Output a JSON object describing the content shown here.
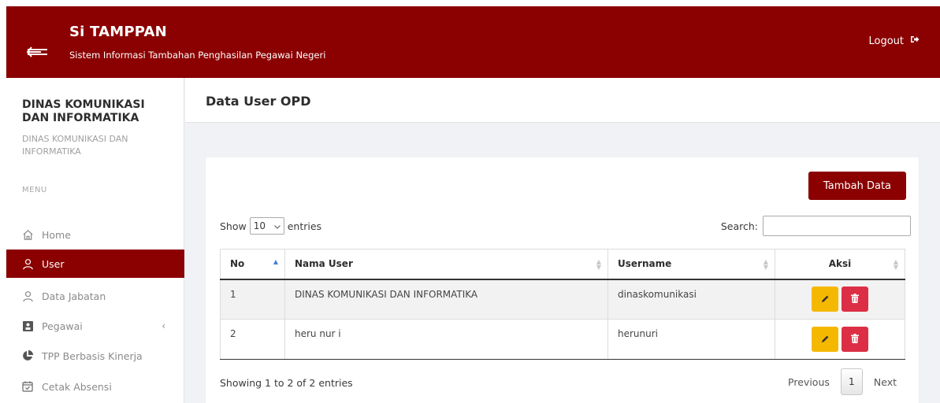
{
  "header": {
    "title": "Si TAMPPAN",
    "subtitle": "Sistem Informasi Tambahan Penghasilan Pegawai Negeri",
    "logout_label": "Logout"
  },
  "sidebar": {
    "org_name": "DINAS KOMUNIKASI DAN INFORMATIKA",
    "org_sub": "DINAS KOMUNIKASI DAN INFORMATIKA",
    "menu_label": "MENU",
    "items": [
      {
        "label": "Home",
        "icon": "home-icon"
      },
      {
        "label": "User",
        "icon": "user-icon",
        "active": true
      },
      {
        "label": "Data Jabatan",
        "icon": "user-icon"
      },
      {
        "label": "Pegawai",
        "icon": "id-card-icon",
        "has_children": true
      },
      {
        "label": "TPP Berbasis Kinerja",
        "icon": "pie-chart-icon"
      },
      {
        "label": "Cetak Absensi",
        "icon": "calendar-check-icon"
      }
    ]
  },
  "page": {
    "title": "Data User OPD",
    "add_button": "Tambah Data",
    "show_label": "Show",
    "entries_label": "entries",
    "length_value": "10",
    "search_label": "Search:",
    "search_value": ""
  },
  "table": {
    "columns": [
      "No",
      "Nama User",
      "Username",
      "Aksi"
    ],
    "rows": [
      {
        "no": "1",
        "nama": "DINAS KOMUNIKASI DAN INFORMATIKA",
        "username": "dinaskomunikasi"
      },
      {
        "no": "2",
        "nama": "heru nur i",
        "username": "herunuri"
      }
    ]
  },
  "footer": {
    "info": "Showing 1 to 2 of 2 entries",
    "previous": "Previous",
    "current_page": "1",
    "next": "Next"
  },
  "colors": {
    "brand": "#8b0000",
    "edit": "#f5b800",
    "delete": "#dc2f45"
  }
}
